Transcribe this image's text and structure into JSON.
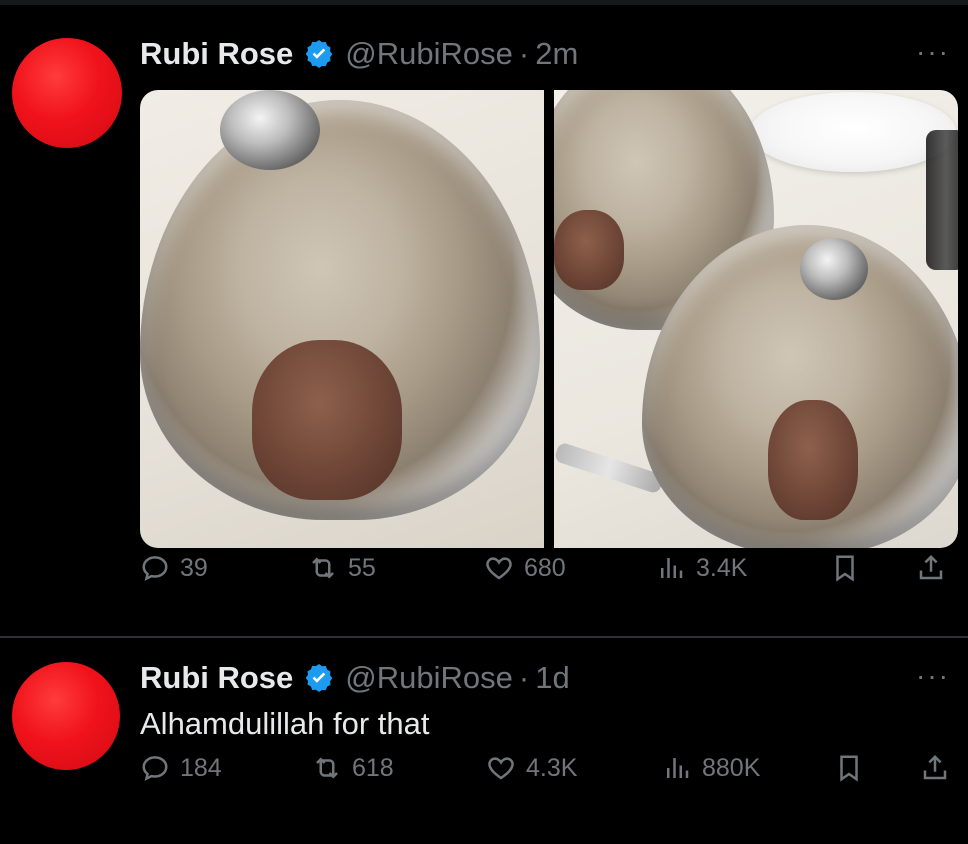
{
  "tweets": [
    {
      "name": "Rubi Rose",
      "handle": "@RubiRose",
      "separator": "·",
      "time": "2m",
      "text": "",
      "more_label": "···",
      "has_media": true,
      "stats": {
        "replies": "39",
        "retweets": "55",
        "likes": "680",
        "views": "3.4K"
      }
    },
    {
      "name": "Rubi Rose",
      "handle": "@RubiRose",
      "separator": "·",
      "time": "1d",
      "text": "Alhamdulillah for that",
      "more_label": "···",
      "has_media": false,
      "stats": {
        "replies": "184",
        "retweets": "618",
        "likes": "4.3K",
        "views": "880K"
      }
    }
  ],
  "colors": {
    "background": "#000000",
    "text": "#e7e9ea",
    "muted": "#71767b",
    "verified": "#1d9bf0",
    "avatar": "#f0121b"
  },
  "icons": {
    "reply": "speech-bubble-icon",
    "retweet": "retweet-arrows-icon",
    "like": "heart-icon",
    "views": "bar-chart-icon",
    "bookmark": "bookmark-icon",
    "share": "share-upload-icon",
    "more": "ellipsis-icon",
    "verified": "verified-badge-icon"
  }
}
